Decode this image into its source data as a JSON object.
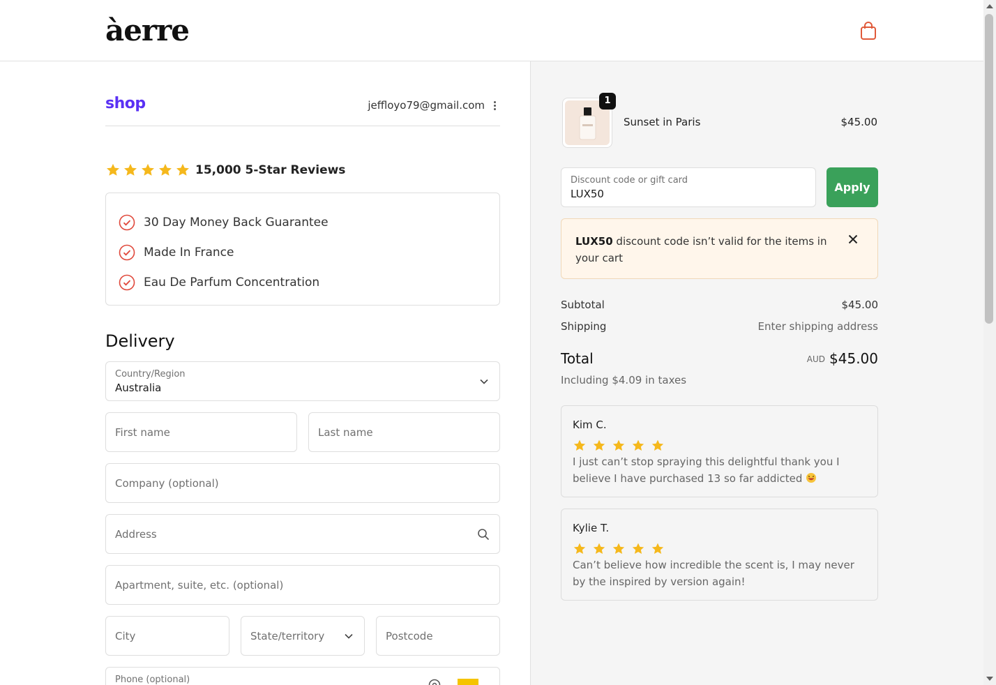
{
  "brand": {
    "logo_text": "àerre"
  },
  "shop_pay": {
    "logo": "shop",
    "email": "jeffloyo79@gmail.com"
  },
  "rating": {
    "summary": "15,000 5-Star Reviews",
    "star_color": "#f5b81c"
  },
  "guarantees": [
    {
      "text": "30 Day Money Back Guarantee"
    },
    {
      "text": "Made In France"
    },
    {
      "text": "Eau De Parfum Concentration"
    }
  ],
  "delivery": {
    "title": "Delivery",
    "country_label": "Country/Region",
    "country_value": "Australia",
    "first_name_placeholder": "First name",
    "last_name_placeholder": "Last name",
    "company_placeholder": "Company (optional)",
    "address_placeholder": "Address",
    "apartment_placeholder": "Apartment, suite, etc. (optional)",
    "city_placeholder": "City",
    "state_placeholder": "State/territory",
    "postcode_placeholder": "Postcode",
    "phone_placeholder": "Phone (optional)"
  },
  "order": {
    "item_name": "Sunset in Paris",
    "item_price": "$45.00",
    "quantity": "1",
    "discount_label": "Discount code or gift card",
    "discount_value": "LUX50",
    "apply_label": "Apply",
    "error_code": "LUX50",
    "error_text": " discount code isn’t valid for the items in your cart",
    "subtotal_label": "Subtotal",
    "subtotal_value": "$45.00",
    "shipping_label": "Shipping",
    "shipping_value": "Enter shipping address",
    "total_label": "Total",
    "total_currency": "AUD",
    "total_value": "$45.00",
    "tax_note": "Including $4.09 in taxes"
  },
  "reviews": [
    {
      "name": "Kim C.",
      "text": "I just can’t stop spraying this delightful thank you I believe I have purchased 13 so far addicted"
    },
    {
      "name": "Kylie T.",
      "text": "Can’t believe how incredible the scent is, I may never by the inspired by version again!"
    }
  ],
  "colors": {
    "accent_green": "#3aa15a",
    "shop_purple": "#5a31f4",
    "check_red": "#e0483b",
    "cart_orange": "#e05a3a"
  }
}
